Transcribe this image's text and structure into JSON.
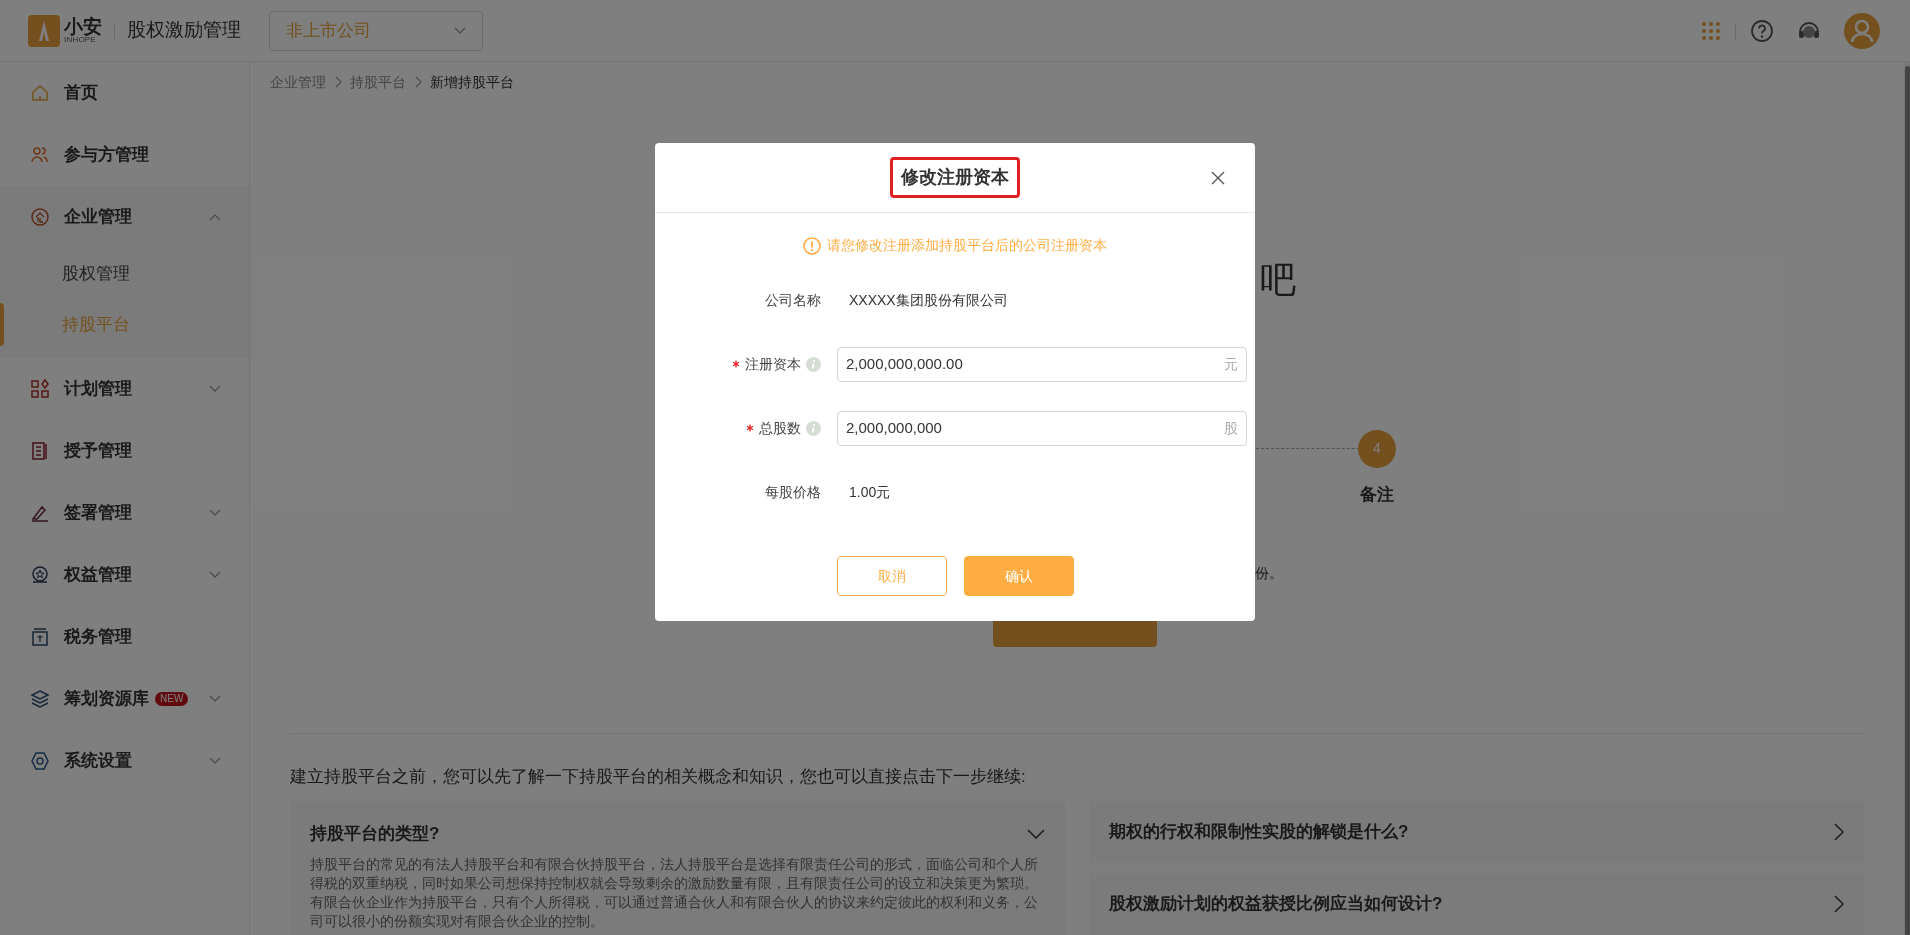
{
  "header": {
    "logo_text": "小安",
    "logo_sub": "INHOPE",
    "app_title": "股权激励管理",
    "company_select": "非上市公司"
  },
  "sidebar": {
    "items": [
      {
        "label": "首页",
        "selected": false
      },
      {
        "label": "参与方管理",
        "selected": false
      },
      {
        "label": "企业管理",
        "selected": false,
        "expanded": true,
        "children": [
          {
            "label": "股权管理",
            "selected": false
          },
          {
            "label": "持股平台",
            "selected": true
          }
        ]
      },
      {
        "label": "计划管理",
        "selected": false,
        "expanded": false
      },
      {
        "label": "授予管理",
        "selected": false
      },
      {
        "label": "签署管理",
        "selected": false,
        "expanded": false
      },
      {
        "label": "权益管理",
        "selected": false,
        "expanded": false
      },
      {
        "label": "税务管理",
        "selected": false
      },
      {
        "label": "筹划资源库",
        "selected": false,
        "expanded": false,
        "badge": "NEW"
      },
      {
        "label": "系统设置",
        "selected": false,
        "expanded": false
      }
    ]
  },
  "breadcrumbs": [
    "企业管理",
    "持股平台",
    "新增持股平台"
  ],
  "background": {
    "heading_fragment": "吧",
    "step": {
      "number": "4",
      "label": "备注"
    },
    "description_fragment": "份。"
  },
  "modal": {
    "title": "修改注册资本",
    "notice": "请您修改注册添加持股平台后的公司注册资本",
    "fields": [
      {
        "kind": "text",
        "label": "公司名称",
        "value": "XXXXX集团股份有限公司"
      },
      {
        "kind": "input",
        "label": "注册资本",
        "required": true,
        "value": "2,000,000,000.00",
        "unit": "元"
      },
      {
        "kind": "input",
        "label": "总股数",
        "required": true,
        "value": "2,000,000,000",
        "unit": "股"
      },
      {
        "kind": "text",
        "label": "每股价格",
        "value": "1.00元"
      }
    ],
    "buttons": [
      {
        "kind": "secondary",
        "label": "取消"
      },
      {
        "kind": "primary",
        "label": "确认"
      }
    ]
  },
  "knowledge": {
    "intro": "建立持股平台之前，您可以先了解一下持股平台的相关概念和知识，您也可以直接点击下一步继续:",
    "faqs": [
      {
        "title": "持股平台的类型?",
        "expanded": true,
        "body": "持股平台的常见的有法人持股平台和有限合伙持股平台，法人持股平台是选择有限责任公司的形式，面临公司和个人所得税的双重纳税，同时如果公司想保持控制权就会导致剩余的激励数量有限，且有限责任公司的设立和决策更为繁琐。有限合伙企业作为持股平台，只有个人所得税，可以通过普通合伙人和有限合伙人的协议来约定彼此的权利和义务，公司可以很小的份额实现对有限合伙企业的控制。"
      },
      {
        "title": "期权的行权和限制性实股的解锁是什么?",
        "expanded": false
      },
      {
        "title": "股权激励计划的权益获授比例应当如何设计?",
        "expanded": false
      }
    ]
  }
}
